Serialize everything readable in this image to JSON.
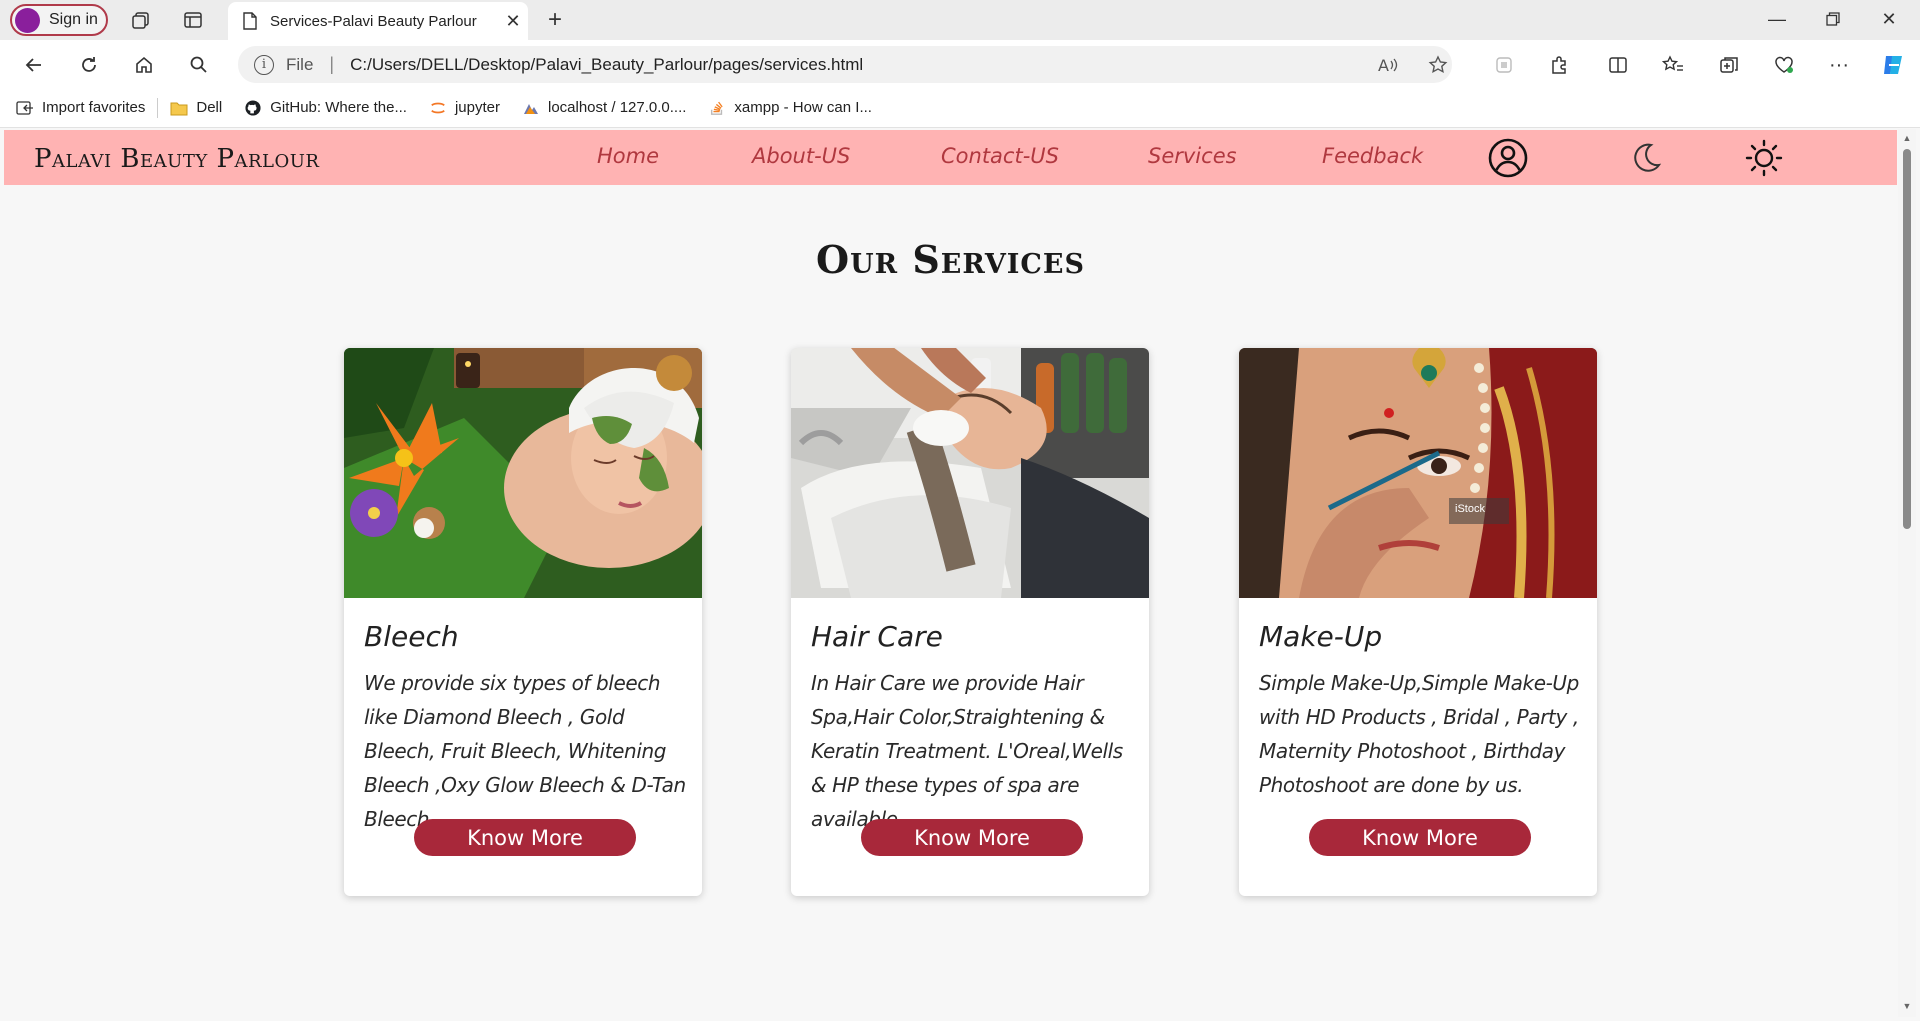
{
  "browser": {
    "profile_label": "Sign in",
    "tab_title": "Services-Palavi Beauty Parlour",
    "url_scheme": "File",
    "url": "C:/Users/DELL/Desktop/Palavi_Beauty_Parlour/pages/services.html",
    "bookmarks": [
      {
        "label": "Import favorites",
        "icon": "import-icon"
      },
      {
        "label": "Dell",
        "icon": "folder-icon"
      },
      {
        "label": "GitHub: Where the...",
        "icon": "github-icon"
      },
      {
        "label": "jupyter",
        "icon": "jupyter-icon"
      },
      {
        "label": "localhost / 127.0.0....",
        "icon": "phpmyadmin-icon"
      },
      {
        "label": "xampp - How can I...",
        "icon": "stackoverflow-icon"
      }
    ]
  },
  "site": {
    "brand": "Palavi Beauty Parlour",
    "nav": [
      "Home",
      "About-US",
      "Contact-US",
      "Services",
      "Feedback"
    ],
    "colors": {
      "nav_bg": "#ffb3b3",
      "accent": "#a8283a",
      "link": "#b0383f"
    }
  },
  "main": {
    "title": "Our Services",
    "cards": [
      {
        "title": "Bleech",
        "text": "We provide six types of bleech like Diamond Bleech , Gold Bleech, Fruit Bleech, Whitening Bleech ,Oxy Glow Bleech & D-Tan Bleech.",
        "button": "Know More",
        "image": "facial-treatment-photo"
      },
      {
        "title": "Hair Care",
        "text": "In Hair Care we provide Hair Spa,Hair Color,Straightening & Keratin Treatment. L'Oreal,Wells & HP these types of spa are available",
        "button": "Know More",
        "image": "hair-wash-photo"
      },
      {
        "title": "Make-Up",
        "text": "Simple Make-Up,Simple Make-Up with HD Products , Bridal , Party , Maternity Photoshoot , Birthday Photoshoot are done by us.",
        "button": "Know More",
        "image": "bridal-makeup-photo",
        "watermark": "iStock"
      }
    ]
  }
}
